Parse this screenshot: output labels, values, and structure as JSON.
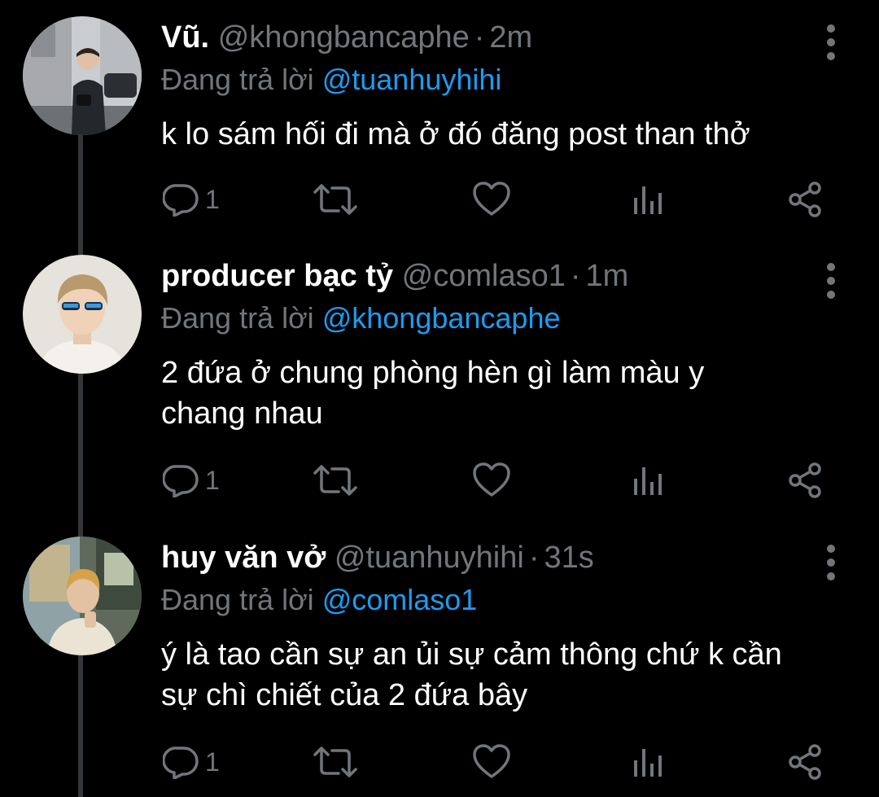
{
  "theme": {
    "background": "#000000",
    "text": "#ffffff",
    "muted": "#71767b",
    "link": "#1d9bf0"
  },
  "tweets": [
    {
      "display_name": "Vũ.",
      "handle": "@khongbancaphe",
      "dot": "·",
      "time": "2m",
      "reply_prefix": "Đang trả lời",
      "reply_to": "@tuanhuyhihi",
      "text": "k lo sám hối đi mà ở đó đăng post than thở",
      "reply_count": "1",
      "avatar_icon": "avatar-photo"
    },
    {
      "display_name": "producer bạc tỷ",
      "handle": "@comlaso1",
      "dot": "·",
      "time": "1m",
      "reply_prefix": "Đang trả lời",
      "reply_to": "@khongbancaphe",
      "text": "2 đứa ở chung phòng hèn gì làm màu y chang nhau",
      "reply_count": "1",
      "avatar_icon": "avatar-photo"
    },
    {
      "display_name": "huy văn vở",
      "handle": "@tuanhuyhihi",
      "dot": "·",
      "time": "31s",
      "reply_prefix": "Đang trả lời",
      "reply_to": "@comlaso1",
      "text": "ý là tao cần sự an ủi sự cảm thông chứ k cần sự chì chiết của 2 đứa bây",
      "reply_count": "1",
      "avatar_icon": "avatar-photo"
    }
  ],
  "action_icons": [
    "reply-icon",
    "retweet-icon",
    "like-icon",
    "analytics-icon",
    "share-icon"
  ]
}
